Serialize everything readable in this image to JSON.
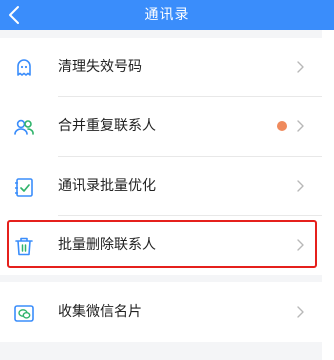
{
  "header": {
    "title": "通讯录"
  },
  "menu": {
    "items": [
      {
        "label": "清理失效号码",
        "icon": "ghost-icon"
      },
      {
        "label": "合并重复联系人",
        "icon": "contacts-merge-icon",
        "badge_color": "#ef8a5d"
      },
      {
        "label": "通讯录批量优化",
        "icon": "checklist-icon"
      },
      {
        "label": "批量删除联系人",
        "icon": "trash-icon",
        "highlighted": true
      }
    ]
  },
  "secondary": {
    "items": [
      {
        "label": "收集微信名片",
        "icon": "wechat-card-icon"
      }
    ]
  },
  "colors": {
    "header": "#3a8dfb",
    "icon_blue": "#3a8dfb",
    "icon_green": "#2fb36b",
    "highlight": "#e5201c"
  }
}
